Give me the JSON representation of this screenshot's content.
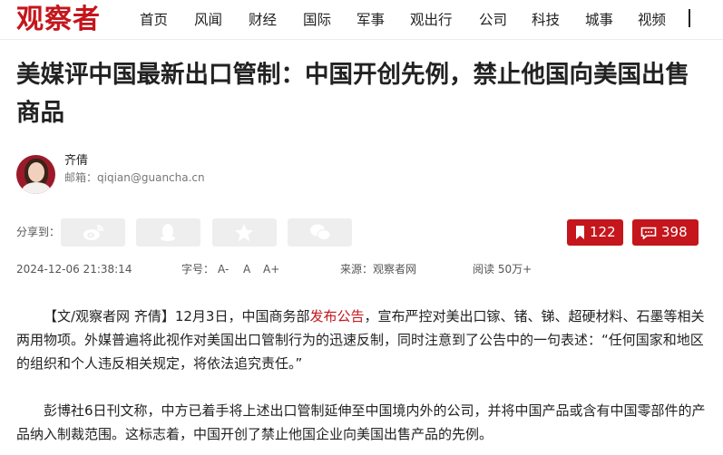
{
  "site": {
    "logo": "观察者"
  },
  "nav": [
    {
      "label": "首页"
    },
    {
      "label": "风闻"
    },
    {
      "label": "财经"
    },
    {
      "label": "国际"
    },
    {
      "label": "军事"
    },
    {
      "label": "观出行"
    },
    {
      "label": "公司"
    },
    {
      "label": "科技"
    },
    {
      "label": "城事"
    },
    {
      "label": "视频"
    }
  ],
  "article": {
    "title": "美媒评中国最新出口管制：中国开创先例，禁止他国向美国出售商品",
    "author": {
      "name": "齐倩",
      "email_label": "邮箱：",
      "email": "qiqian@guancha.cn"
    },
    "share_label": "分享到：",
    "share_icons": [
      "weibo-icon",
      "qq-icon",
      "qzone-star-icon",
      "wechat-icon"
    ],
    "bookmark_count": "122",
    "comment_count": "398",
    "date": "2024-12-06 21:38:14",
    "font_label": "字号：",
    "font_controls": [
      "A-",
      "A",
      "A+"
    ],
    "source": "来源：观察者网",
    "reads": "阅读 50万+",
    "p1_before_link": "【文/观察者网 齐倩】12月3日，中国商务部",
    "p1_link": "发布公告",
    "p1_after_link": "，宣布严控对美出口镓、锗、锑、超硬材料、石墨等相关两用物项。外媒普遍将此视作对美国出口管制行为的迅速反制，同时注意到了公告中的一句表述：“任何国家和地区的组织和个人违反相关规定，将依法追究责任。”",
    "p2": "彭博社6日刊文称，中方已着手将上述出口管制延伸至中国境内外的公司，并将中国产品或含有中国零部件的产品纳入制裁范围。这标志着，中国开创了禁止他国企业向美国出售产品的先例。"
  },
  "colors": {
    "brand": "#c4161c"
  }
}
